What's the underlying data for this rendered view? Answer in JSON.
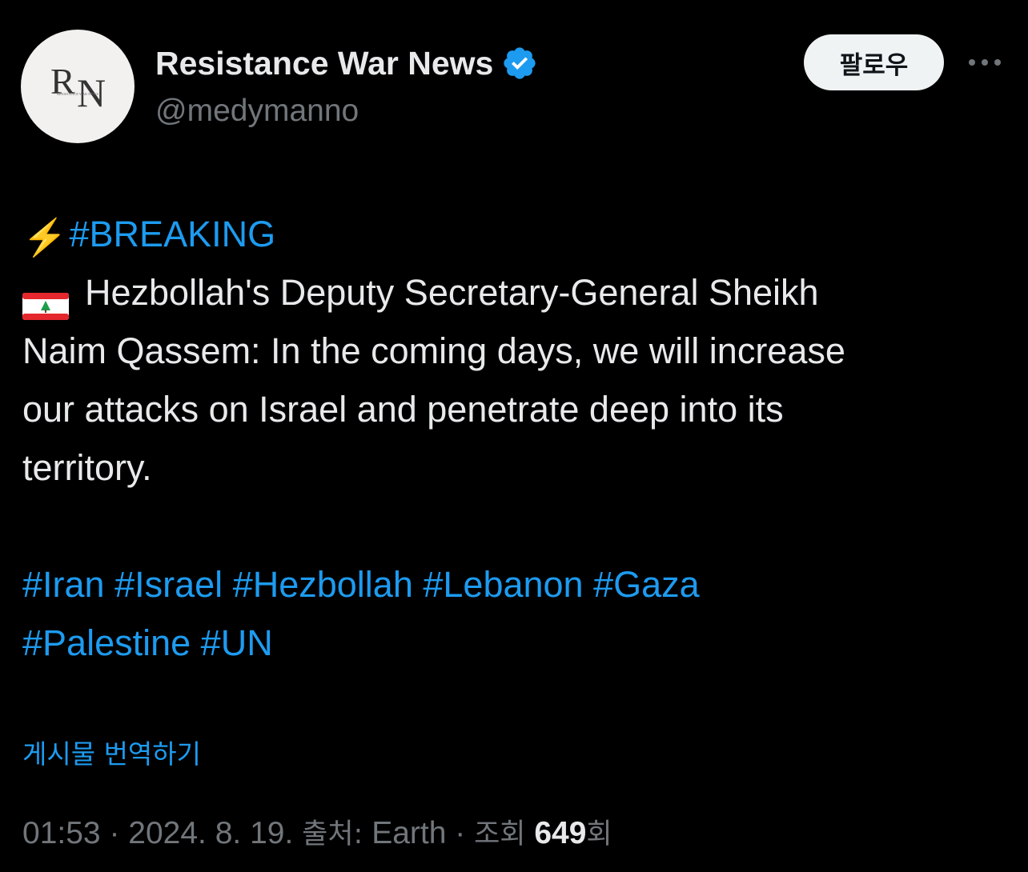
{
  "author": {
    "display_name": "Resistance War News",
    "handle": "@medymanno",
    "avatar_monogram": "RN",
    "avatar_caption": "RESISTANCE WAR NEWS",
    "verified": true
  },
  "actions": {
    "follow_label": "팔로우",
    "more_icon": "more-horizontal-icon"
  },
  "tweet": {
    "bolt_emoji": "⚡",
    "breaking_tag": "#BREAKING",
    "flag_icon": "lebanon-flag-icon",
    "body_lines": [
      "Hezbollah's Deputy Secretary-General Sheikh",
      "Naim Qassem: In the coming days, we will increase",
      "our attacks on Israel and penetrate deep into its",
      "territory."
    ],
    "hashtags_line1": [
      "#Iran",
      "#Israel",
      "#Hezbollah",
      "#Lebanon",
      "#Gaza"
    ],
    "hashtags_line2": [
      "#Palestine",
      "#UN"
    ]
  },
  "translate_label": "게시물 번역하기",
  "meta": {
    "time": "01:53",
    "sep": " · ",
    "date": "2024. 8. 19.",
    "source_label": "출처:",
    "source": "Earth",
    "views_label": "조회",
    "views_count": "649",
    "views_suffix": "회"
  },
  "colors": {
    "background": "#000000",
    "text": "#e7e9ea",
    "muted": "#71767b",
    "accent": "#1d9bf0"
  }
}
